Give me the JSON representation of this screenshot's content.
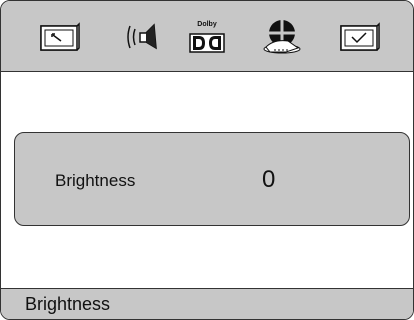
{
  "tabs": [
    {
      "icon": "wrench-screen-icon"
    },
    {
      "icon": "speaker-icon"
    },
    {
      "icon": "dolby-icon",
      "label": "Dolby"
    },
    {
      "icon": "film-reel-icon"
    },
    {
      "icon": "checkmark-screen-icon"
    }
  ],
  "setting": {
    "label": "Brightness",
    "value": "0"
  },
  "status": {
    "text": "Brightness"
  },
  "colors": {
    "panel": "#c7c7c7",
    "border": "#333333",
    "background": "#ffffff"
  }
}
